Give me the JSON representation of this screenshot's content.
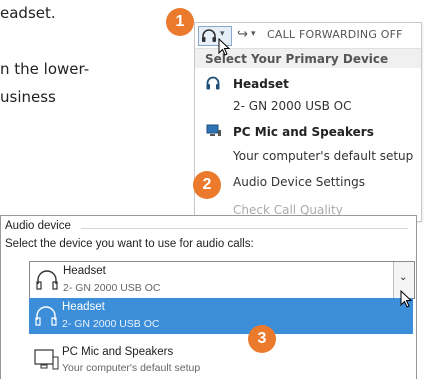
{
  "doc": {
    "line1": "eadset.",
    "line2": "n the lower-",
    "line3": "usiness"
  },
  "menu": {
    "toolbar": {
      "audio_caret": "▾",
      "forward_caret": "▾",
      "forward_icon": "↪",
      "forward_label": "CALL FORWARDING OFF"
    },
    "header": "Select Your Primary Device",
    "items": [
      {
        "label": "Headset",
        "icon": "headset-icon",
        "style": "bold"
      },
      {
        "label": "2- GN 2000 USB OC",
        "style": "normal"
      },
      {
        "label": "PC Mic and Speakers",
        "icon": "pc-speakers-icon",
        "style": "bold"
      },
      {
        "label": "Your computer's default setup",
        "style": "normal"
      },
      {
        "label": "Audio Device Settings",
        "style": "normal"
      },
      {
        "label": "Check Call Quality",
        "style": "disabled"
      }
    ]
  },
  "badges": [
    "1",
    "2",
    "3"
  ],
  "dialog": {
    "section_label": "Audio device",
    "instruction": "Select the device you want to use for audio calls:",
    "combo": {
      "name": "Headset",
      "detail": "2- GN 2000 USB OC",
      "caret": "⌄"
    },
    "options": [
      {
        "name": "Headset",
        "detail": "2- GN 2000 USB OC",
        "selected": true
      },
      {
        "name": "PC Mic and Speakers",
        "detail": "Your computer's default setup",
        "selected": false
      }
    ]
  },
  "colors": {
    "accent_orange": "#ec7a2d",
    "selection_blue": "#3c8ed8",
    "header_gray": "#f0f0f0"
  }
}
